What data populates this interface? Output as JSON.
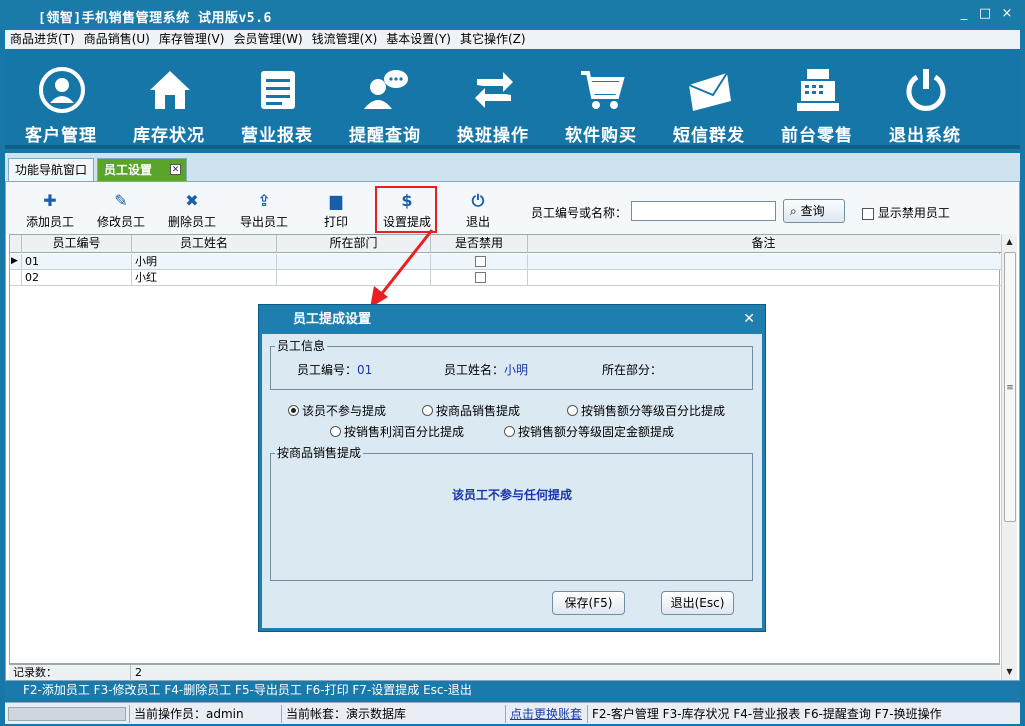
{
  "window": {
    "title": "[领智]手机销售管理系统 试用版v5.6",
    "min": "_",
    "max": "□",
    "close": "×"
  },
  "menu": [
    "商品进货(T)",
    "商品销售(U)",
    "库存管理(V)",
    "会员管理(W)",
    "钱流管理(X)",
    "基本设置(Y)",
    "其它操作(Z)"
  ],
  "big_toolbar": [
    {
      "label": "客户管理",
      "icon": "user-icon"
    },
    {
      "label": "库存状况",
      "icon": "house-icon"
    },
    {
      "label": "营业报表",
      "icon": "report-icon"
    },
    {
      "label": "提醒查询",
      "icon": "chat-user-icon"
    },
    {
      "label": "换班操作",
      "icon": "swap-icon"
    },
    {
      "label": "软件购买",
      "icon": "cart-icon"
    },
    {
      "label": "短信群发",
      "icon": "envelope-icon"
    },
    {
      "label": "前台零售",
      "icon": "cash-register-icon"
    },
    {
      "label": "退出系统",
      "icon": "power-icon"
    }
  ],
  "tabs": [
    {
      "label": "功能导航窗口"
    },
    {
      "label": "员工设置"
    }
  ],
  "toolbar": {
    "add": "添加员工",
    "edit": "修改员工",
    "delete": "删除员工",
    "export": "导出员工",
    "print": "打印",
    "commission": "设置提成",
    "exit": "退出",
    "search_label": "员工编号或名称：",
    "search_value": "",
    "search_button": "查询",
    "show_disabled": "显示禁用员工"
  },
  "grid": {
    "columns": [
      "员工编号",
      "员工姓名",
      "所在部门",
      "是否禁用",
      "备注"
    ],
    "rows": [
      {
        "id": "01",
        "name": "小明",
        "dept": "",
        "disabled": false,
        "note": ""
      },
      {
        "id": "02",
        "name": "小红",
        "dept": "",
        "disabled": false,
        "note": ""
      }
    ],
    "footer_label": "记录数：",
    "footer_count": "2"
  },
  "shortcut_bar": "F2-添加员工 F3-修改员工 F4-删除员工 F5-导出员工 F6-打印 F7-设置提成 Esc-退出",
  "status": {
    "operator": "当前操作员：admin",
    "account": "当前帐套：演示数据库",
    "switch_link": "点击更换账套",
    "hotkeys": "F2-客户管理 F3-库存状况 F4-营业报表 F6-提醒查询 F7-换班操作"
  },
  "dialog": {
    "title": "员工提成设置",
    "info_legend": "员工信息",
    "id_label": "员工编号：",
    "id_value": "01",
    "name_label": "员工姓名：",
    "name_value": "小明",
    "dept_label": "所在部分：",
    "dept_value": "",
    "options": [
      {
        "label": "该员不参与提成",
        "selected": true
      },
      {
        "label": "按商品销售提成",
        "selected": false
      },
      {
        "label": "按销售额分等级百分比提成",
        "selected": false
      },
      {
        "label": "按销售利润百分比提成",
        "selected": false
      },
      {
        "label": "按销售额分等级固定金额提成",
        "selected": false
      }
    ],
    "section_legend": "按商品销售提成",
    "message": "该员工不参与任何提成",
    "save": "保存(F5)",
    "cancel": "退出(Esc)"
  },
  "colors": {
    "accent": "#1776a8",
    "tab_active": "#5aa42a",
    "highlight": "#e82020",
    "link": "#1a36a8"
  }
}
